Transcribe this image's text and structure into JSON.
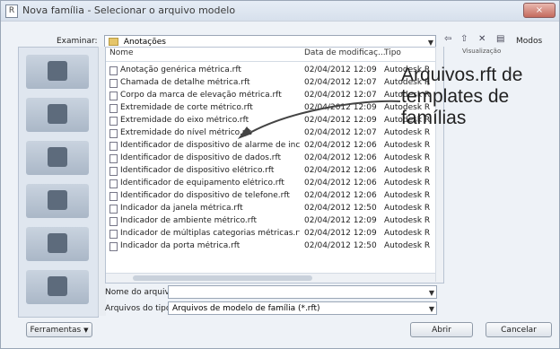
{
  "window": {
    "title": "Nova família - Selecionar o arquivo modelo",
    "app_icon": "R",
    "close_label": "×"
  },
  "toolbar": {
    "look_in_label": "Examinar:",
    "look_in_value": "Anotações",
    "back_icon": "⇦",
    "up_icon": "⇧",
    "delete_icon": "✕",
    "views_icon": "▤",
    "views_label": "Modos",
    "views_caption": "Visualização"
  },
  "file_list": {
    "columns": [
      "Nome",
      "Data de modificaç...",
      "Tipo"
    ],
    "rows": [
      {
        "name": "Anotação genérica métrica.rft",
        "date": "02/04/2012 12:09",
        "type": "Autodesk R"
      },
      {
        "name": "Chamada de detalhe métrica.rft",
        "date": "02/04/2012 12:07",
        "type": "Autodesk R"
      },
      {
        "name": "Corpo da marca de elevação métrica.rft",
        "date": "02/04/2012 12:07",
        "type": "Autodesk R"
      },
      {
        "name": "Extremidade de corte métrico.rft",
        "date": "02/04/2012 12:09",
        "type": "Autodesk R"
      },
      {
        "name": "Extremidade do eixo métrico.rft",
        "date": "02/04/2012 12:09",
        "type": "Autodesk R"
      },
      {
        "name": "Extremidade do nível métrico.rft",
        "date": "02/04/2012 12:07",
        "type": "Autodesk R"
      },
      {
        "name": "Identificador de dispositivo de alarme de inc...",
        "date": "02/04/2012 12:06",
        "type": "Autodesk R"
      },
      {
        "name": "Identificador de dispositivo de dados.rft",
        "date": "02/04/2012 12:06",
        "type": "Autodesk R"
      },
      {
        "name": "Identificador de dispositivo elétrico.rft",
        "date": "02/04/2012 12:06",
        "type": "Autodesk R"
      },
      {
        "name": "Identificador de equipamento elétrico.rft",
        "date": "02/04/2012 12:06",
        "type": "Autodesk R"
      },
      {
        "name": "Identificador do dispositivo de telefone.rft",
        "date": "02/04/2012 12:06",
        "type": "Autodesk R"
      },
      {
        "name": "Indicador da janela métrica.rft",
        "date": "02/04/2012 12:50",
        "type": "Autodesk R"
      },
      {
        "name": "Indicador de ambiente métrico.rft",
        "date": "02/04/2012 12:09",
        "type": "Autodesk R"
      },
      {
        "name": "Indicador de múltiplas categorias métricas.rft",
        "date": "02/04/2012 12:09",
        "type": "Autodesk R"
      },
      {
        "name": "Indicador da porta métrica.rft",
        "date": "02/04/2012 12:50",
        "type": "Autodesk R"
      }
    ]
  },
  "annotation": {
    "line1": "Arquivos.rft de",
    "line2": "templates de",
    "line3": "famílias"
  },
  "footer": {
    "filename_label": "Nome do arquivo:",
    "filename_value": "",
    "filetype_label": "Arquivos do tipo:",
    "filetype_value": "Arquivos de modelo de família (*.rft)",
    "tools_label": "Ferramentas",
    "open_label": "Abrir",
    "cancel_label": "Cancelar"
  },
  "colors": {
    "accent": "#3b6ea5",
    "window_bg": "#eef2f7"
  }
}
